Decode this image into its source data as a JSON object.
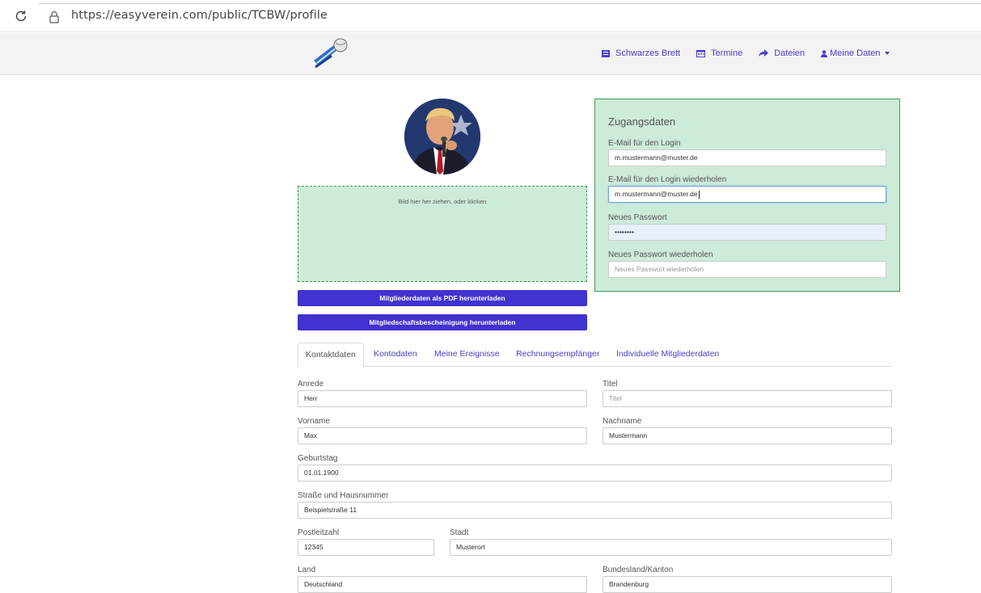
{
  "browser": {
    "url": "https://easyverein.com/public/TCBW/profile"
  },
  "nav": {
    "items": [
      {
        "label": "Schwarzes Brett",
        "icon": "newspaper-icon"
      },
      {
        "label": "Termine",
        "icon": "calendar-icon"
      },
      {
        "label": "Dateien",
        "icon": "share-arrow-icon"
      },
      {
        "label": "Meine Daten",
        "icon": "user-icon"
      }
    ]
  },
  "dropzone": {
    "text": "Bild hier her ziehen, oder klicken"
  },
  "buttons": {
    "pdf": "Mitgliederdaten als PDF herunterladen",
    "certificate": "Mitgliedschaftsbescheinigung herunterladen"
  },
  "login": {
    "title": "Zugangsdaten",
    "email_label": "E-Mail für den Login",
    "email_value": "m.mustermann@muster.de",
    "email_repeat_label": "E-Mail für den Login wiederholen",
    "email_repeat_value": "m.mustermann@muster.de",
    "password_label": "Neues Passwort",
    "password_value": "••••••••",
    "password_repeat_label": "Neues Passwort wiederholen",
    "password_repeat_placeholder": "Neues Passwort wiederholen"
  },
  "tabs": [
    "Kontaktdaten",
    "Kontodaten",
    "Meine Ereignisse",
    "Rechnungsempfänger",
    "Individuelle Mitgliederdaten"
  ],
  "form": {
    "anrede": {
      "label": "Anrede",
      "value": "Herr"
    },
    "titel": {
      "label": "Titel",
      "placeholder": "Titel"
    },
    "vorname": {
      "label": "Vorname",
      "value": "Max"
    },
    "nachname": {
      "label": "Nachname",
      "value": "Mustermann"
    },
    "geburtstag": {
      "label": "Geburtstag",
      "value": "01.01.1900"
    },
    "strasse": {
      "label": "Straße und Hausnummer",
      "value": "Beispielstraße 11"
    },
    "plz": {
      "label": "Postleitzahl",
      "value": "12345"
    },
    "stadt": {
      "label": "Stadt",
      "value": "Musterort"
    },
    "land": {
      "label": "Land",
      "value": "Deutschland"
    },
    "bundesland": {
      "label": "Bundesland/Kanton",
      "value": "Brandenburg"
    }
  },
  "colors": {
    "accent": "#4232d0",
    "link": "#4a3ec9",
    "panel_green": "#cdebd9",
    "panel_border": "#3e9a5a"
  }
}
